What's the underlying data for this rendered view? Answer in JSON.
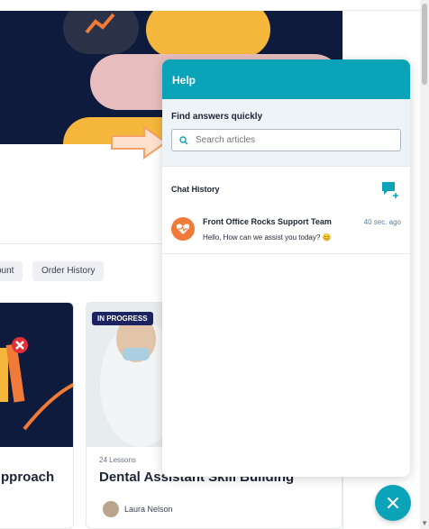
{
  "background": {
    "filter_chips": [
      "ount",
      "Order History"
    ],
    "cards": [
      {
        "title": "pproach"
      },
      {
        "badge": "IN PROGRESS",
        "lessons": "24 Lessons",
        "title": "Dental Assistant Skill Building",
        "author": "Laura Nelson"
      }
    ]
  },
  "help": {
    "header_title": "Help",
    "search_title": "Find answers quickly",
    "search_placeholder": "Search articles",
    "chat_history_label": "Chat History",
    "conversation": {
      "name": "Front Office Rocks Support Team",
      "time": "40 sec. ago",
      "message": "Hello, How can we assist you today? 😊"
    }
  },
  "colors": {
    "accent": "#0aa3b8",
    "hero_bg": "#0f1b3d",
    "avatar": "#f07a37"
  },
  "icons": {
    "search": "search-icon",
    "new_chat": "chat-plus-icon",
    "fab": "close-icon"
  }
}
